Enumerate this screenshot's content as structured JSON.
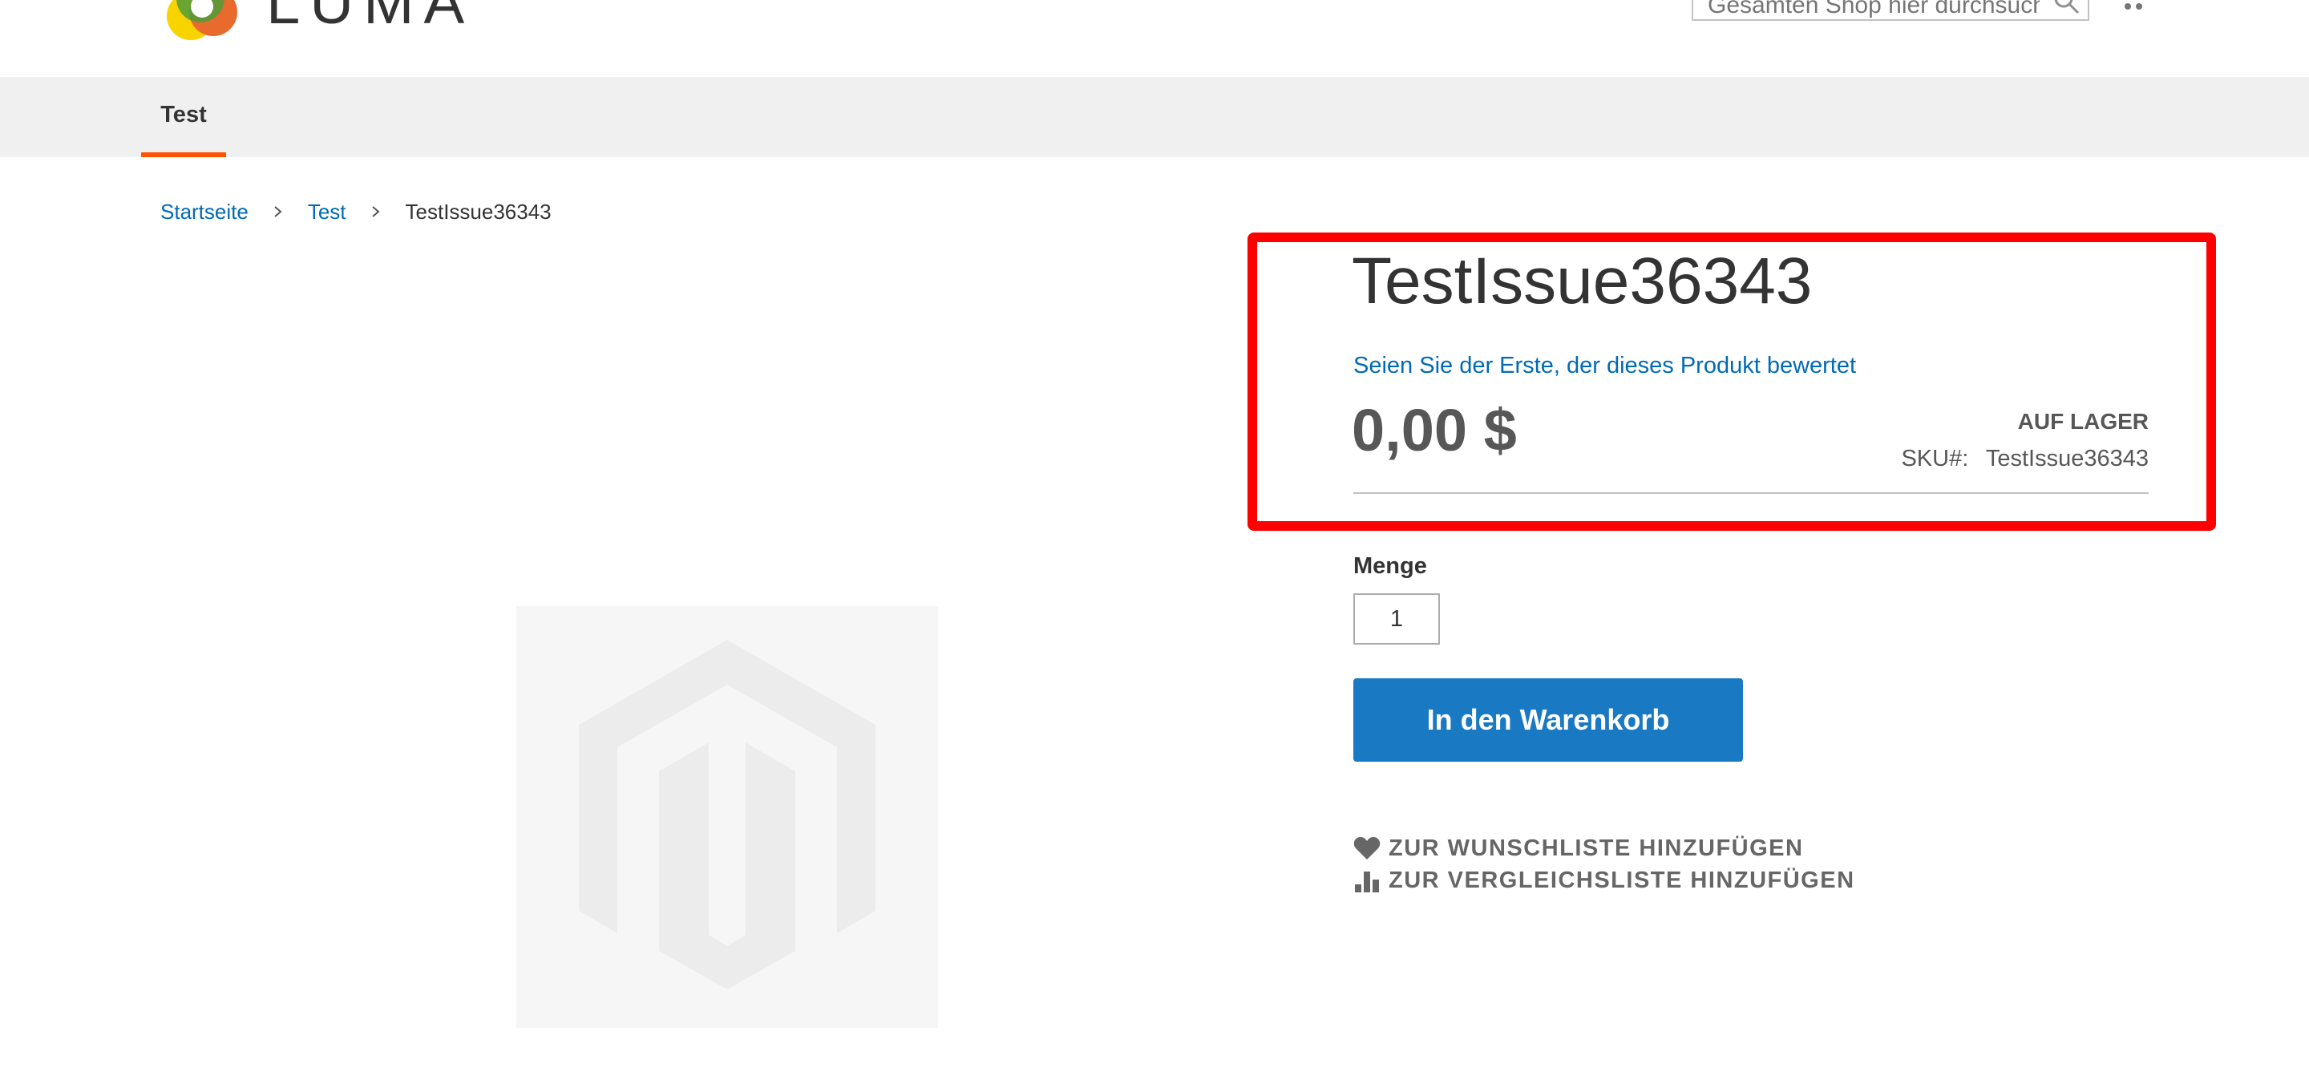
{
  "header": {
    "logo_text": "LUMA",
    "search_placeholder": "Gesamten Shop hier durchsuchen..."
  },
  "nav": {
    "items": [
      {
        "label": "Test",
        "active": true
      }
    ]
  },
  "breadcrumb": {
    "items": [
      "Startseite",
      "Test"
    ],
    "current": "TestIssue36343"
  },
  "product": {
    "title": "TestIssue36343",
    "review_link": "Seien Sie der Erste, der dieses Produkt bewertet",
    "price": "0,00 $",
    "stock_status": "AUF LAGER",
    "sku_label": "SKU#:",
    "sku_value": "TestIssue36343",
    "qty_label": "Menge",
    "qty_value": "1",
    "add_to_cart_label": "In den Warenkorb",
    "wishlist_label": "ZUR WUNSCHLISTE HINZUFÜGEN",
    "compare_label": "ZUR VERGLEICHSLISTE HINZUFÜGEN"
  },
  "colors": {
    "accent": "#ff5501",
    "link": "#006bb4",
    "primary_button": "#1979c3",
    "highlight": "#ff0000"
  }
}
